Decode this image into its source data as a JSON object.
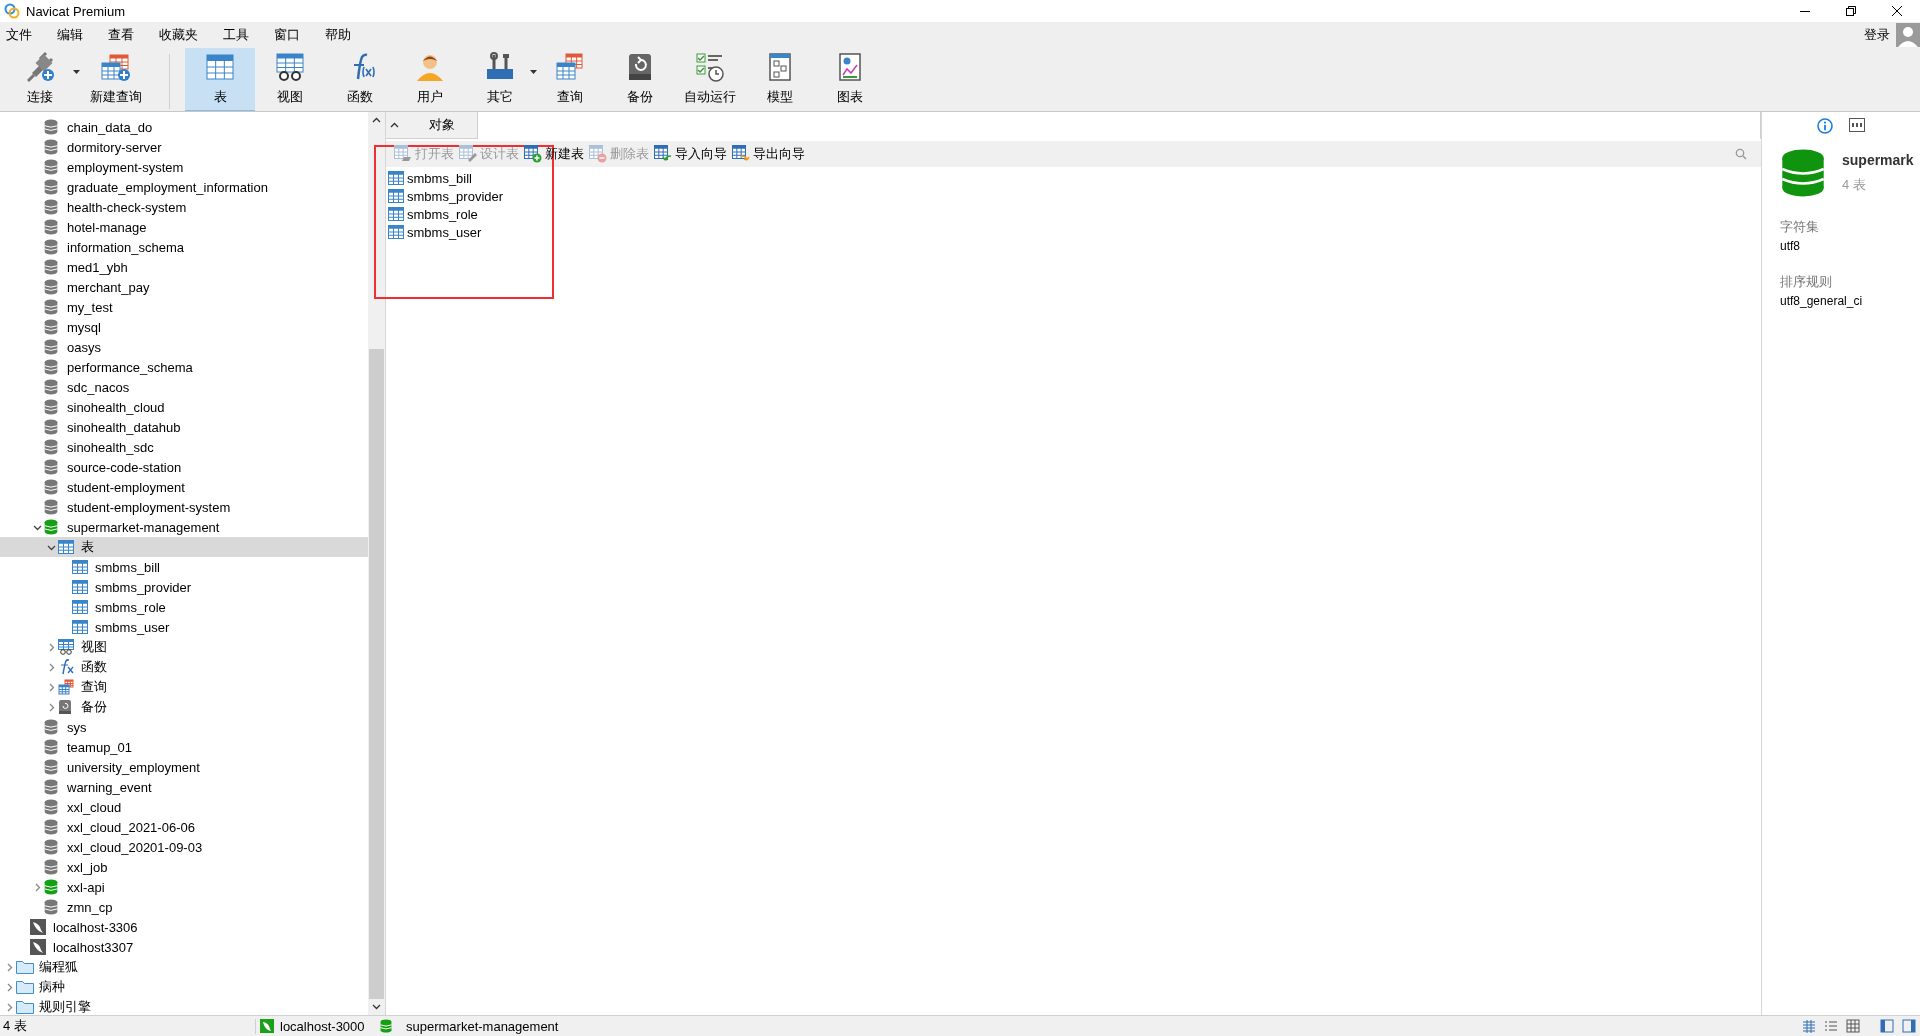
{
  "window": {
    "title": "Navicat Premium"
  },
  "menu": [
    "文件",
    "编辑",
    "查看",
    "收藏夹",
    "工具",
    "窗口",
    "帮助"
  ],
  "login": {
    "label": "登录"
  },
  "toolbar": [
    {
      "label": "连接",
      "dropdown": true,
      "selected": false
    },
    {
      "label": "新建查询",
      "dropdown": false,
      "selected": false
    },
    {
      "label": "表",
      "dropdown": false,
      "selected": true
    },
    {
      "label": "视图",
      "dropdown": false,
      "selected": false
    },
    {
      "label": "函数",
      "dropdown": false,
      "selected": false
    },
    {
      "label": "用户",
      "dropdown": false,
      "selected": false
    },
    {
      "label": "其它",
      "dropdown": true,
      "selected": false
    },
    {
      "label": "查询",
      "dropdown": false,
      "selected": false
    },
    {
      "label": "备份",
      "dropdown": false,
      "selected": false
    },
    {
      "label": "自动运行",
      "dropdown": false,
      "selected": false
    },
    {
      "label": "模型",
      "dropdown": false,
      "selected": false
    },
    {
      "label": "图表",
      "dropdown": false,
      "selected": false
    }
  ],
  "tree": {
    "items": [
      {
        "label": "chain_data_do",
        "kind": "database",
        "open": false,
        "selected": false
      },
      {
        "label": "dormitory-server",
        "kind": "database",
        "open": false,
        "selected": false
      },
      {
        "label": "employment-system",
        "kind": "database",
        "open": false,
        "selected": false
      },
      {
        "label": "graduate_employment_information",
        "kind": "database",
        "open": false,
        "selected": false
      },
      {
        "label": "health-check-system",
        "kind": "database",
        "open": false,
        "selected": false
      },
      {
        "label": "hotel-manage",
        "kind": "database",
        "open": false,
        "selected": false
      },
      {
        "label": "information_schema",
        "kind": "database",
        "open": false,
        "selected": false
      },
      {
        "label": "med1_ybh",
        "kind": "database",
        "open": false,
        "selected": false
      },
      {
        "label": "merchant_pay",
        "kind": "database",
        "open": false,
        "selected": false
      },
      {
        "label": "my_test",
        "kind": "database",
        "open": false,
        "selected": false
      },
      {
        "label": "mysql",
        "kind": "database",
        "open": false,
        "selected": false
      },
      {
        "label": "oasys",
        "kind": "database",
        "open": false,
        "selected": false
      },
      {
        "label": "performance_schema",
        "kind": "database",
        "open": false,
        "selected": false
      },
      {
        "label": "sdc_nacos",
        "kind": "database",
        "open": false,
        "selected": false
      },
      {
        "label": "sinohealth_cloud",
        "kind": "database",
        "open": false,
        "selected": false
      },
      {
        "label": "sinohealth_datahub",
        "kind": "database",
        "open": false,
        "selected": false
      },
      {
        "label": "sinohealth_sdc",
        "kind": "database",
        "open": false,
        "selected": false
      },
      {
        "label": "source-code-station",
        "kind": "database",
        "open": false,
        "selected": false
      },
      {
        "label": "student-employment",
        "kind": "database",
        "open": false,
        "selected": false
      },
      {
        "label": "student-employment-system",
        "kind": "database",
        "open": false,
        "selected": false
      },
      {
        "label": "supermarket-management",
        "kind": "database",
        "open": true,
        "expanded": true,
        "selected": false,
        "children": [
          {
            "label": "表",
            "kind": "tables",
            "expanded": true,
            "selected": true,
            "children": [
              {
                "label": "smbms_bill",
                "kind": "table",
                "selected": false
              },
              {
                "label": "smbms_provider",
                "kind": "table",
                "selected": false
              },
              {
                "label": "smbms_role",
                "kind": "table",
                "selected": false
              },
              {
                "label": "smbms_user",
                "kind": "table",
                "selected": false
              }
            ]
          },
          {
            "label": "视图",
            "kind": "views",
            "expanded": false,
            "selected": false
          },
          {
            "label": "函数",
            "kind": "functions",
            "expanded": false,
            "selected": false
          },
          {
            "label": "查询",
            "kind": "queries",
            "expanded": false,
            "selected": false
          },
          {
            "label": "备份",
            "kind": "backups",
            "expanded": false,
            "selected": false
          }
        ]
      },
      {
        "label": "sys",
        "kind": "database",
        "open": false,
        "selected": false
      },
      {
        "label": "teamup_01",
        "kind": "database",
        "open": false,
        "selected": false
      },
      {
        "label": "university_employment",
        "kind": "database",
        "open": false,
        "selected": false
      },
      {
        "label": "warning_event",
        "kind": "database",
        "open": false,
        "selected": false
      },
      {
        "label": "xxl_cloud",
        "kind": "database",
        "open": false,
        "selected": false
      },
      {
        "label": "xxl_cloud_2021-06-06",
        "kind": "database",
        "open": false,
        "selected": false
      },
      {
        "label": "xxl_cloud_20201-09-03",
        "kind": "database",
        "open": false,
        "selected": false
      },
      {
        "label": "xxl_job",
        "kind": "database",
        "open": false,
        "selected": false
      },
      {
        "label": "xxl-api",
        "kind": "database",
        "open": true,
        "expanded": false,
        "selected": false
      },
      {
        "label": "zmn_cp",
        "kind": "database",
        "open": false,
        "selected": false
      },
      {
        "label": "localhost-3306",
        "kind": "connection",
        "selected": false
      },
      {
        "label": "localhost3307",
        "kind": "connection",
        "selected": false
      },
      {
        "label": "编程狐",
        "kind": "group",
        "expanded": false,
        "selected": false
      },
      {
        "label": "病种",
        "kind": "group",
        "expanded": false,
        "selected": false
      },
      {
        "label": "规则引擎",
        "kind": "group",
        "expanded": false,
        "selected": false
      }
    ]
  },
  "objects": {
    "tabs": [
      {
        "label": "对象",
        "selected": true
      }
    ],
    "actions": [
      {
        "label": "打开表",
        "disabled": true
      },
      {
        "label": "设计表",
        "disabled": true
      },
      {
        "label": "新建表",
        "disabled": false
      },
      {
        "label": "删除表",
        "disabled": true
      },
      {
        "label": "导入向导",
        "disabled": false
      },
      {
        "label": "导出向导",
        "disabled": false
      }
    ],
    "items": [
      {
        "label": "smbms_bill",
        "selected": false
      },
      {
        "label": "smbms_provider",
        "selected": false
      },
      {
        "label": "smbms_role",
        "selected": false
      },
      {
        "label": "smbms_user",
        "selected": false
      }
    ]
  },
  "info": {
    "name": "supermark",
    "count": "4 表",
    "fields": [
      {
        "label": "字符集",
        "value": "utf8"
      },
      {
        "label": "排序规则",
        "value": "utf8_general_ci"
      }
    ]
  },
  "status_bar": {
    "summary": "4 表",
    "connection": "localhost-3000",
    "database": "supermarket-management"
  }
}
